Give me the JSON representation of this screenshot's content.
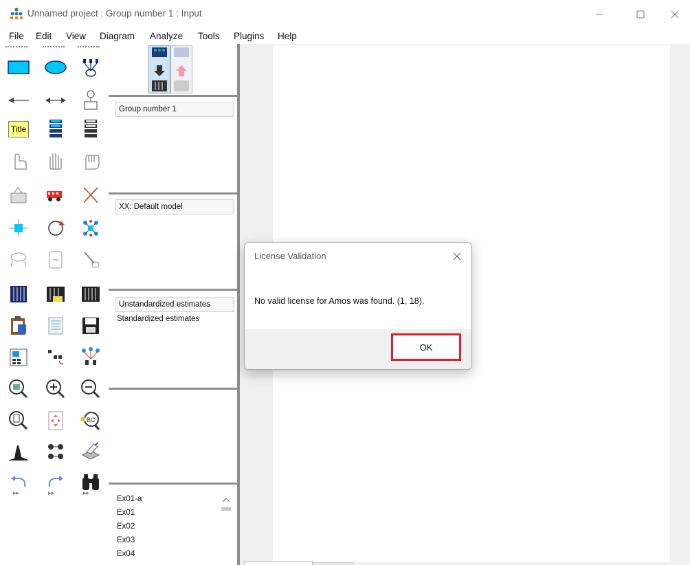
{
  "window": {
    "title": "Unnamed project : Group number 1 : Input",
    "icon": "amos-tree-icon"
  },
  "menu": [
    "File",
    "Edit",
    "View",
    "Diagram",
    "Analyze",
    "Tools",
    "Plugins",
    "Help"
  ],
  "toolbox": {
    "title_tool_label": "Title",
    "icons": [
      "rectangle-icon",
      "ellipse-icon",
      "latent-indicator-icon",
      "single-arrow-icon",
      "double-arrow-icon",
      "unique-variable-icon",
      "title-icon",
      "list-variables-icon",
      "list-data-variables-icon",
      "select-one-icon",
      "select-all-icon",
      "deselect-all-icon",
      "duplicate-icon",
      "move-icon",
      "erase-icon",
      "change-shape-icon",
      "rotate-icon",
      "reflect-icon",
      "move-parameter-icon",
      "scroll-icon",
      "touch-up-icon",
      "data-file-icon",
      "analysis-properties-icon",
      "calculate-estimates-icon",
      "copy-clipboard-icon",
      "view-text-icon",
      "save-icon",
      "object-properties-icon",
      "drag-properties-icon",
      "preserve-symmetries-icon",
      "zoom-selected-icon",
      "zoom-in-icon",
      "zoom-out-icon",
      "page-zoom-icon",
      "fit-page-icon",
      "loupe-icon",
      "bayesian-icon",
      "multiple-group-icon",
      "print-icon",
      "undo-icon",
      "redo-icon",
      "specification-search-icon"
    ]
  },
  "panel": {
    "groups": [
      "Group number 1"
    ],
    "model": "XX: Default model",
    "estimates": [
      "Unstandardized estimates",
      "Standardized estimates"
    ],
    "files": [
      "Ex01-a",
      "Ex01",
      "Ex02",
      "Ex03",
      "Ex04"
    ]
  },
  "dialog": {
    "title": "License Validation",
    "message": "No valid license for Amos was found. (1, 18).",
    "ok_label": "OK",
    "highlight_color": "#e0202a"
  }
}
